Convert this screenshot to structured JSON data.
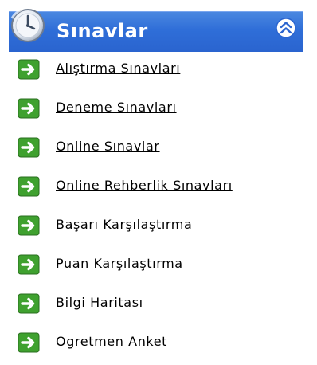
{
  "panel": {
    "title": "Sınavlar",
    "header_icon": "clock-icon",
    "collapse_icon": "double-chevron-up-icon",
    "item_icon": "green-arrow-right-icon",
    "colors": {
      "header": "#2f6ed8",
      "title_text": "#ffffff",
      "arrow_green": "#3fa12f",
      "link_text": "#000000"
    }
  },
  "items": [
    {
      "label": "Alıştırma Sınavları"
    },
    {
      "label": "Deneme Sınavları"
    },
    {
      "label": "Online Sınavlar"
    },
    {
      "label": "Online Rehberlik Sınavları"
    },
    {
      "label": "Başarı Karşılaştırma"
    },
    {
      "label": "Puan Karşılaştırma"
    },
    {
      "label": "Bilgi Haritası"
    },
    {
      "label": "Ogretmen Anket"
    }
  ]
}
